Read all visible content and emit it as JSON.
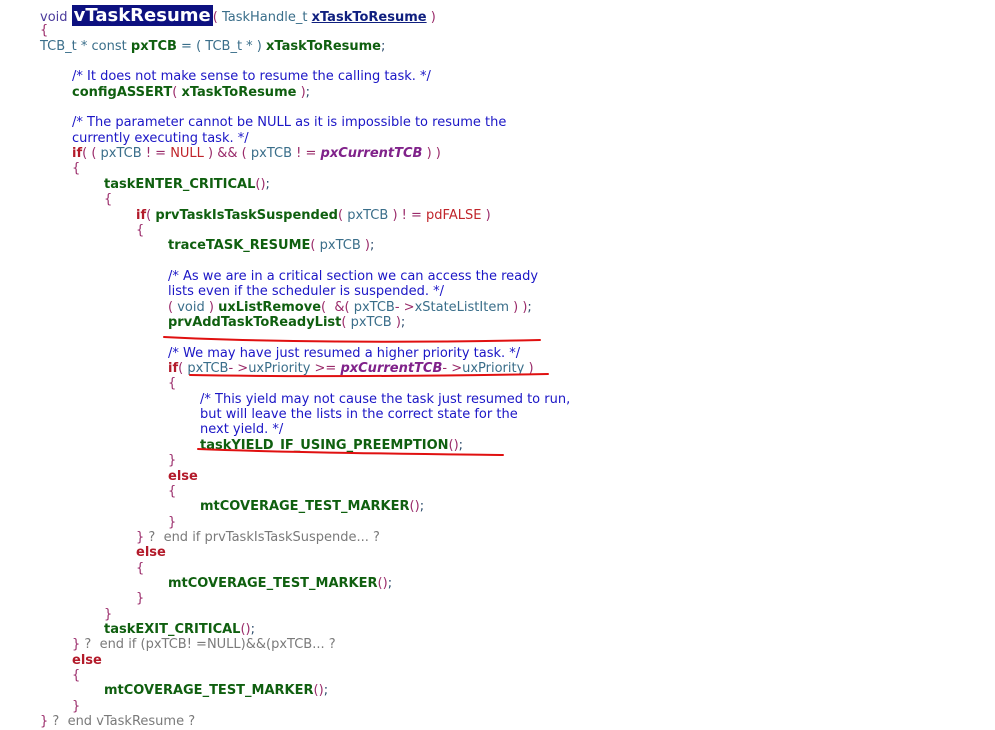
{
  "code": {
    "lines": [
      {
        "indent": 0,
        "tokens": [
          [
            "kw",
            "void "
          ],
          [
            "func",
            "vTaskResume"
          ],
          [
            "paren",
            "( "
          ],
          [
            "plain",
            "TaskHandle_t "
          ],
          [
            "param",
            "xTaskToResume"
          ],
          [
            "paren",
            " )"
          ]
        ]
      },
      {
        "indent": 0,
        "tokens": [
          [
            "paren",
            "{"
          ]
        ]
      },
      {
        "indent": 0,
        "tokens": [
          [
            "plain",
            "TCB_t * const "
          ],
          [
            "bold",
            "pxTCB"
          ],
          [
            "plain",
            " = ( TCB_t * ) "
          ],
          [
            "bold",
            "xTaskToResume"
          ],
          [
            "punct",
            ";"
          ]
        ]
      },
      {
        "indent": 1,
        "gap": true,
        "tokens": [
          [
            "com",
            "/* It does not make sense to resume the calling task. */"
          ]
        ]
      },
      {
        "indent": 1,
        "tokens": [
          [
            "bold",
            "configASSERT"
          ],
          [
            "paren",
            "( "
          ],
          [
            "bold",
            "xTaskToResume"
          ],
          [
            "paren",
            " )"
          ],
          [
            "punct",
            ";"
          ]
        ]
      },
      {
        "indent": 1,
        "gap": true,
        "tokens": [
          [
            "com",
            "/* The parameter cannot be NULL as it is impossible to resume the"
          ]
        ]
      },
      {
        "indent": 1,
        "tokens": [
          [
            "com",
            "currently executing task. */"
          ]
        ]
      },
      {
        "indent": 1,
        "tokens": [
          [
            "ctl",
            "if"
          ],
          [
            "paren",
            "( ( "
          ],
          [
            "plain",
            "pxTCB "
          ],
          [
            "op",
            "! = "
          ],
          [
            "nul",
            "NULL"
          ],
          [
            "paren",
            " ) && ( "
          ],
          [
            "plain",
            "pxTCB "
          ],
          [
            "op",
            "! = "
          ],
          [
            "gvar",
            "pxCurrentTCB"
          ],
          [
            "paren",
            " ) )"
          ]
        ]
      },
      {
        "indent": 1,
        "tokens": [
          [
            "paren",
            "{"
          ]
        ]
      },
      {
        "indent": 2,
        "tokens": [
          [
            "bold",
            "taskENTER_CRITICAL"
          ],
          [
            "paren",
            "()"
          ],
          [
            "punct",
            ";"
          ]
        ]
      },
      {
        "indent": 2,
        "tokens": [
          [
            "paren",
            "{"
          ]
        ]
      },
      {
        "indent": 3,
        "tokens": [
          [
            "ctl",
            "if"
          ],
          [
            "paren",
            "( "
          ],
          [
            "bold",
            "prvTaskIsTaskSuspended"
          ],
          [
            "paren",
            "( "
          ],
          [
            "plain",
            "pxTCB "
          ],
          [
            "paren",
            ") "
          ],
          [
            "op",
            "! = "
          ],
          [
            "nul",
            "pdFALSE"
          ],
          [
            "paren",
            " )"
          ]
        ]
      },
      {
        "indent": 3,
        "tokens": [
          [
            "paren",
            "{"
          ]
        ]
      },
      {
        "indent": 4,
        "tokens": [
          [
            "bold",
            "traceTASK_RESUME"
          ],
          [
            "paren",
            "( "
          ],
          [
            "plain",
            "pxTCB "
          ],
          [
            "paren",
            ")"
          ],
          [
            "punct",
            ";"
          ]
        ]
      },
      {
        "indent": 4,
        "gap": true,
        "tokens": [
          [
            "com",
            "/* As we are in a critical section we can access the ready"
          ]
        ]
      },
      {
        "indent": 4,
        "tokens": [
          [
            "com",
            "lists even if the scheduler is suspended. */"
          ]
        ]
      },
      {
        "indent": 4,
        "tokens": [
          [
            "paren",
            "( "
          ],
          [
            "plain",
            "void "
          ],
          [
            "paren",
            ") "
          ],
          [
            "bold",
            "uxListRemove"
          ],
          [
            "paren",
            "(  &( "
          ],
          [
            "plain",
            "pxTCB"
          ],
          [
            "op",
            "- >"
          ],
          [
            "memb",
            "xStateListItem"
          ],
          [
            "paren",
            " ) )"
          ],
          [
            "punct",
            ";"
          ]
        ]
      },
      {
        "indent": 4,
        "tokens": [
          [
            "bold",
            "prvAddTaskToReadyList"
          ],
          [
            "paren",
            "( "
          ],
          [
            "plain",
            "pxTCB "
          ],
          [
            "paren",
            ")"
          ],
          [
            "punct",
            ";"
          ]
        ]
      },
      {
        "indent": 4,
        "gap": true,
        "tokens": [
          [
            "com",
            "/* We may have just resumed a higher priority task. */"
          ]
        ]
      },
      {
        "indent": 4,
        "tokens": [
          [
            "ctl",
            "if"
          ],
          [
            "paren",
            "( "
          ],
          [
            "plain",
            "pxTCB"
          ],
          [
            "op",
            "- >"
          ],
          [
            "memb",
            "uxPriority "
          ],
          [
            "op",
            ">= "
          ],
          [
            "gvar",
            "pxCurrentTCB"
          ],
          [
            "op",
            "- >"
          ],
          [
            "memb",
            "uxPriority "
          ],
          [
            "paren",
            ")"
          ]
        ]
      },
      {
        "indent": 4,
        "tokens": [
          [
            "paren",
            "{"
          ]
        ]
      },
      {
        "indent": 5,
        "tokens": [
          [
            "com",
            "/* This yield may not cause the task just resumed to run,"
          ]
        ]
      },
      {
        "indent": 5,
        "tokens": [
          [
            "com",
            "but will leave the lists in the correct state for the"
          ]
        ]
      },
      {
        "indent": 5,
        "tokens": [
          [
            "com",
            "next yield. */"
          ]
        ]
      },
      {
        "indent": 5,
        "tokens": [
          [
            "bold",
            "taskYIELD_IF_USING_PREEMPTION"
          ],
          [
            "paren",
            "()"
          ],
          [
            "punct",
            ";"
          ]
        ]
      },
      {
        "indent": 4,
        "tokens": [
          [
            "paren",
            "}"
          ]
        ]
      },
      {
        "indent": 4,
        "tokens": [
          [
            "ctl",
            "else"
          ]
        ]
      },
      {
        "indent": 4,
        "tokens": [
          [
            "paren",
            "{"
          ]
        ]
      },
      {
        "indent": 5,
        "tokens": [
          [
            "bold",
            "mtCOVERAGE_TEST_MARKER"
          ],
          [
            "paren",
            "()"
          ],
          [
            "punct",
            ";"
          ]
        ]
      },
      {
        "indent": 4,
        "tokens": [
          [
            "paren",
            "}"
          ]
        ]
      },
      {
        "indent": 3,
        "tokens": [
          [
            "paren",
            "} "
          ],
          [
            "fold",
            "?  end if prvTaskIsTaskSuspende... ?"
          ]
        ]
      },
      {
        "indent": 3,
        "tokens": [
          [
            "ctl",
            "else"
          ]
        ]
      },
      {
        "indent": 3,
        "tokens": [
          [
            "paren",
            "{"
          ]
        ]
      },
      {
        "indent": 4,
        "tokens": [
          [
            "bold",
            "mtCOVERAGE_TEST_MARKER"
          ],
          [
            "paren",
            "()"
          ],
          [
            "punct",
            ";"
          ]
        ]
      },
      {
        "indent": 3,
        "tokens": [
          [
            "paren",
            "}"
          ]
        ]
      },
      {
        "indent": 2,
        "tokens": [
          [
            "paren",
            "}"
          ]
        ]
      },
      {
        "indent": 2,
        "tokens": [
          [
            "bold",
            "taskEXIT_CRITICAL"
          ],
          [
            "paren",
            "()"
          ],
          [
            "punct",
            ";"
          ]
        ]
      },
      {
        "indent": 1,
        "tokens": [
          [
            "paren",
            "} "
          ],
          [
            "fold",
            "?  end if (pxTCB! =NULL)&&(pxTCB... ?"
          ]
        ]
      },
      {
        "indent": 1,
        "tokens": [
          [
            "ctl",
            "else"
          ]
        ]
      },
      {
        "indent": 1,
        "tokens": [
          [
            "paren",
            "{"
          ]
        ]
      },
      {
        "indent": 2,
        "tokens": [
          [
            "bold",
            "mtCOVERAGE_TEST_MARKER"
          ],
          [
            "paren",
            "()"
          ],
          [
            "punct",
            ";"
          ]
        ]
      },
      {
        "indent": 1,
        "tokens": [
          [
            "paren",
            "}"
          ]
        ]
      },
      {
        "indent": 0,
        "tokens": [
          [
            "paren",
            "} "
          ],
          [
            "fold",
            "?  end vTaskResume ?"
          ]
        ]
      }
    ]
  },
  "colors": {
    "highlight_bg": "#0d1180",
    "annotation_red": "#e01010"
  }
}
